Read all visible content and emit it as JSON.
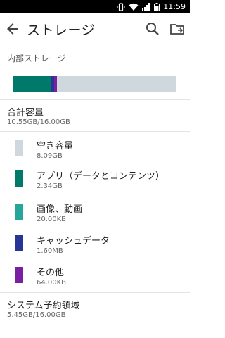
{
  "status_bar": {
    "time": "11:59"
  },
  "header": {
    "title": "ストレージ"
  },
  "internal": {
    "section_label": "内部ストレージ",
    "segments": [
      {
        "name": "app",
        "fraction": 0.232,
        "color": "#00796b"
      },
      {
        "name": "cache",
        "fraction": 0.018,
        "color": "#283593"
      },
      {
        "name": "other",
        "fraction": 0.018,
        "color": "#7b1fa2"
      }
    ],
    "bar_background": "#cfd8dc"
  },
  "total": {
    "title": "合計容量",
    "value": "10.55GB/16.00GB"
  },
  "items": [
    {
      "label": "空き容量",
      "size": "8.09GB",
      "color": "#cfd8dc"
    },
    {
      "label": "アプリ（データとコンテンツ）",
      "size": "2.34GB",
      "color": "#00796b"
    },
    {
      "label": "画像、動画",
      "size": "20.00KB",
      "color": "#26a69a"
    },
    {
      "label": "キャッシュデータ",
      "size": "1.60MB",
      "color": "#283593"
    },
    {
      "label": "その他",
      "size": "64.00KB",
      "color": "#7b1fa2"
    }
  ],
  "system": {
    "title": "システム予約領域",
    "value": "5.45GB/16.00GB"
  }
}
